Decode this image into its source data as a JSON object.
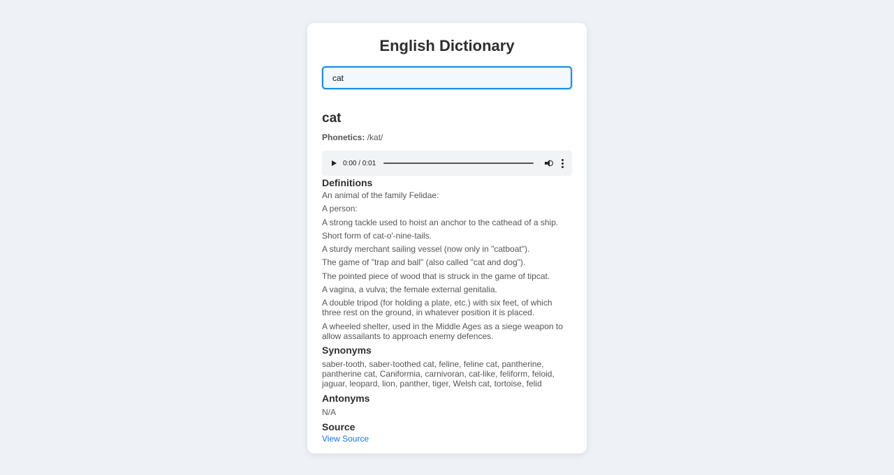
{
  "app": {
    "title": "English Dictionary"
  },
  "search": {
    "value": "cat",
    "placeholder": ""
  },
  "result": {
    "word": "cat",
    "phonetics_label": "Phonetics:",
    "phonetics_value": "/kat/",
    "audio": {
      "time": "0:00 / 0:01",
      "progress": 0
    },
    "definitions_heading": "Definitions",
    "definitions": [
      "An animal of the family Felidae:",
      "A person:",
      "A strong tackle used to hoist an anchor to the cathead of a ship.",
      "Short form of cat-o'-nine-tails.",
      "A sturdy merchant sailing vessel (now only in \"catboat\").",
      "The game of \"trap and ball\" (also called \"cat and dog\").",
      "The pointed piece of wood that is struck in the game of tipcat.",
      "A vagina, a vulva; the female external genitalia.",
      "A double tripod (for holding a plate, etc.) with six feet, of which three rest on the ground, in whatever position it is placed.",
      "A wheeled shelter, used in the Middle Ages as a siege weapon to allow assailants to approach enemy defences."
    ],
    "synonyms_heading": "Synonyms",
    "synonyms": "saber-tooth, saber-toothed cat, feline, feline cat, pantherine, pantherine cat, Caniformia, carnivoran, cat-like, feliform, feloid, jaguar, leopard, lion, panther, tiger, Welsh cat, tortoise, felid",
    "antonyms_heading": "Antonyms",
    "antonyms": "N/A",
    "source_heading": "Source",
    "source_link": "View Source"
  },
  "colors": {
    "accent": "#1a8fe3",
    "link": "#1a73e8",
    "background": "#eef2f7",
    "card": "#ffffff"
  }
}
